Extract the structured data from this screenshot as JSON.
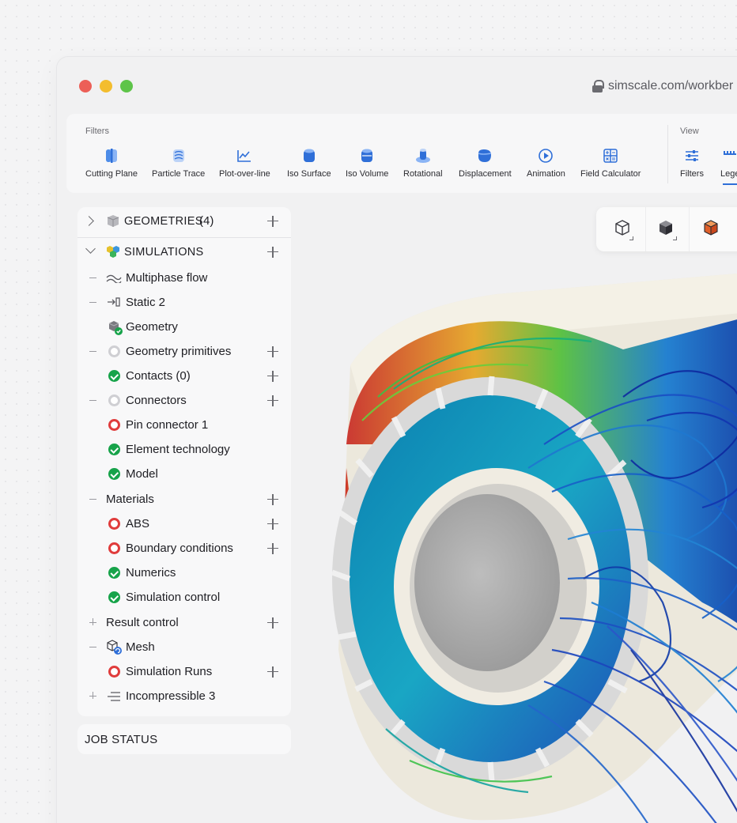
{
  "browser": {
    "url": "simscale.com/workber"
  },
  "toolbar": {
    "filters_label": "Filters",
    "view_label": "View",
    "tools": [
      {
        "label": "Cutting Plane",
        "icon": "cutting-plane-icon"
      },
      {
        "label": "Particle Trace",
        "icon": "particle-trace-icon"
      },
      {
        "label": "Plot-over-line",
        "icon": "plot-over-line-icon"
      },
      {
        "label": "Iso Surface",
        "icon": "iso-surface-icon"
      },
      {
        "label": "Iso Volume",
        "icon": "iso-volume-icon"
      },
      {
        "label": "Rotational",
        "icon": "rotational-icon"
      },
      {
        "label": "Displacement",
        "icon": "displacement-icon"
      },
      {
        "label": "Animation",
        "icon": "animation-icon"
      },
      {
        "label": "Field Calculator",
        "icon": "field-calculator-icon"
      }
    ],
    "view_tools": [
      {
        "label": "Filters",
        "icon": "sliders-icon"
      },
      {
        "label": "Lege",
        "icon": "legend-icon"
      }
    ],
    "accent_color": "#2f6fd8"
  },
  "tree": {
    "geometries_label": "GEOMETRIES",
    "geometries_count": "(4)",
    "simulations_label": "SIMULATIONS",
    "items": [
      {
        "label": "Multiphase flow",
        "icon": "multiphase-icon"
      },
      {
        "label": "Static 2",
        "icon": "static-icon"
      },
      {
        "label": "Geometry",
        "icon": "geometry-icon"
      },
      {
        "label": "Geometry primitives",
        "status": "pending"
      },
      {
        "label": "Contacts (0)",
        "status": "ok"
      },
      {
        "label": "Connectors",
        "status": "pending"
      },
      {
        "label": "Pin connector 1",
        "status": "error"
      },
      {
        "label": "Element technology",
        "status": "ok"
      },
      {
        "label": "Model",
        "status": "ok"
      },
      {
        "label": "Materials"
      },
      {
        "label": "ABS",
        "status": "error"
      },
      {
        "label": "Boundary conditions",
        "status": "error"
      },
      {
        "label": "Numerics",
        "status": "ok"
      },
      {
        "label": "Simulation control",
        "status": "ok"
      },
      {
        "label": "Result control"
      },
      {
        "label": "Mesh",
        "icon": "mesh-icon"
      },
      {
        "label": "Simulation Runs",
        "status": "error"
      },
      {
        "label": "Incompressible 3",
        "icon": "incompressible-icon"
      }
    ],
    "status_colors": {
      "ok": "#17a34a",
      "error": "#e03c3c",
      "pending": "#cfcfd3"
    }
  },
  "job_status": {
    "label": "JOB STATUS"
  },
  "viewcube": {
    "icons": [
      "wireframe-cube-icon",
      "solid-cube-icon",
      "highlighted-cube-icon"
    ]
  }
}
